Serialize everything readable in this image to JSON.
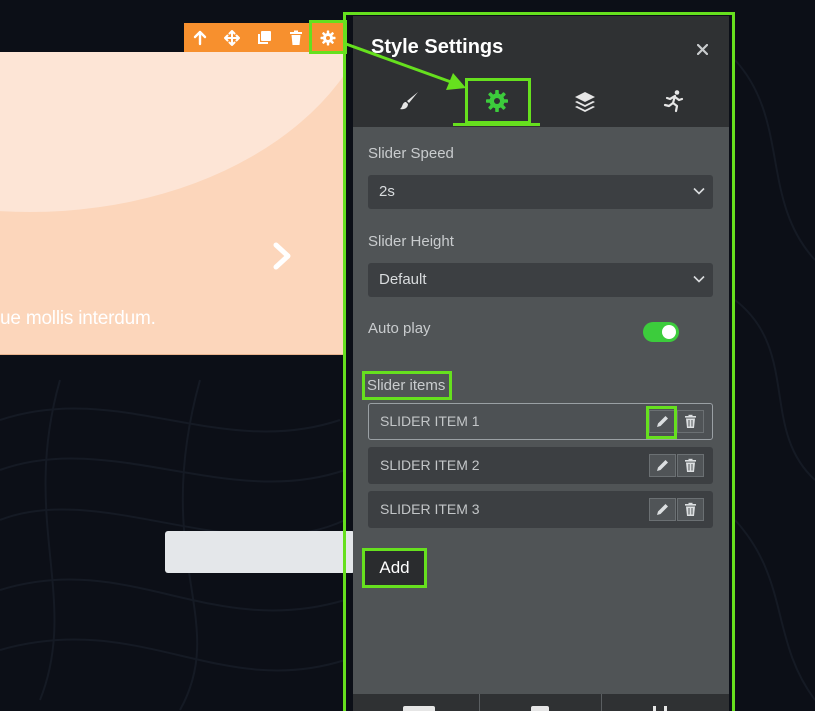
{
  "canvas": {
    "slide_text": "ue mollis interdum.",
    "next_icon": "chevron-right-icon",
    "toolbar_icons": [
      "arrow-up-icon",
      "move-icon",
      "duplicate-icon",
      "trash-icon",
      "gear-icon"
    ]
  },
  "panel": {
    "title": "Style Settings",
    "close_label": "×",
    "tabs": [
      {
        "icon": "brush-icon"
      },
      {
        "icon": "gear-icon",
        "active": true
      },
      {
        "icon": "layers-icon"
      },
      {
        "icon": "running-person-icon"
      }
    ],
    "slider_speed": {
      "label": "Slider Speed",
      "value": "2s"
    },
    "slider_height": {
      "label": "Slider Height",
      "value": "Default"
    },
    "auto_play": {
      "label": "Auto play",
      "enabled": true
    },
    "slider_items": {
      "label": "Slider items",
      "items": [
        "SLIDER ITEM 1",
        "SLIDER ITEM 2",
        "SLIDER ITEM 3"
      ]
    },
    "add_label": "Add"
  },
  "colors": {
    "highlight": "#66e01e",
    "toolbar": "#f7902e",
    "panel_bg": "#505456",
    "panel_header": "#2f3133",
    "toggle_on": "#3ccc3c",
    "slide_bg": "#fcd6bb"
  }
}
